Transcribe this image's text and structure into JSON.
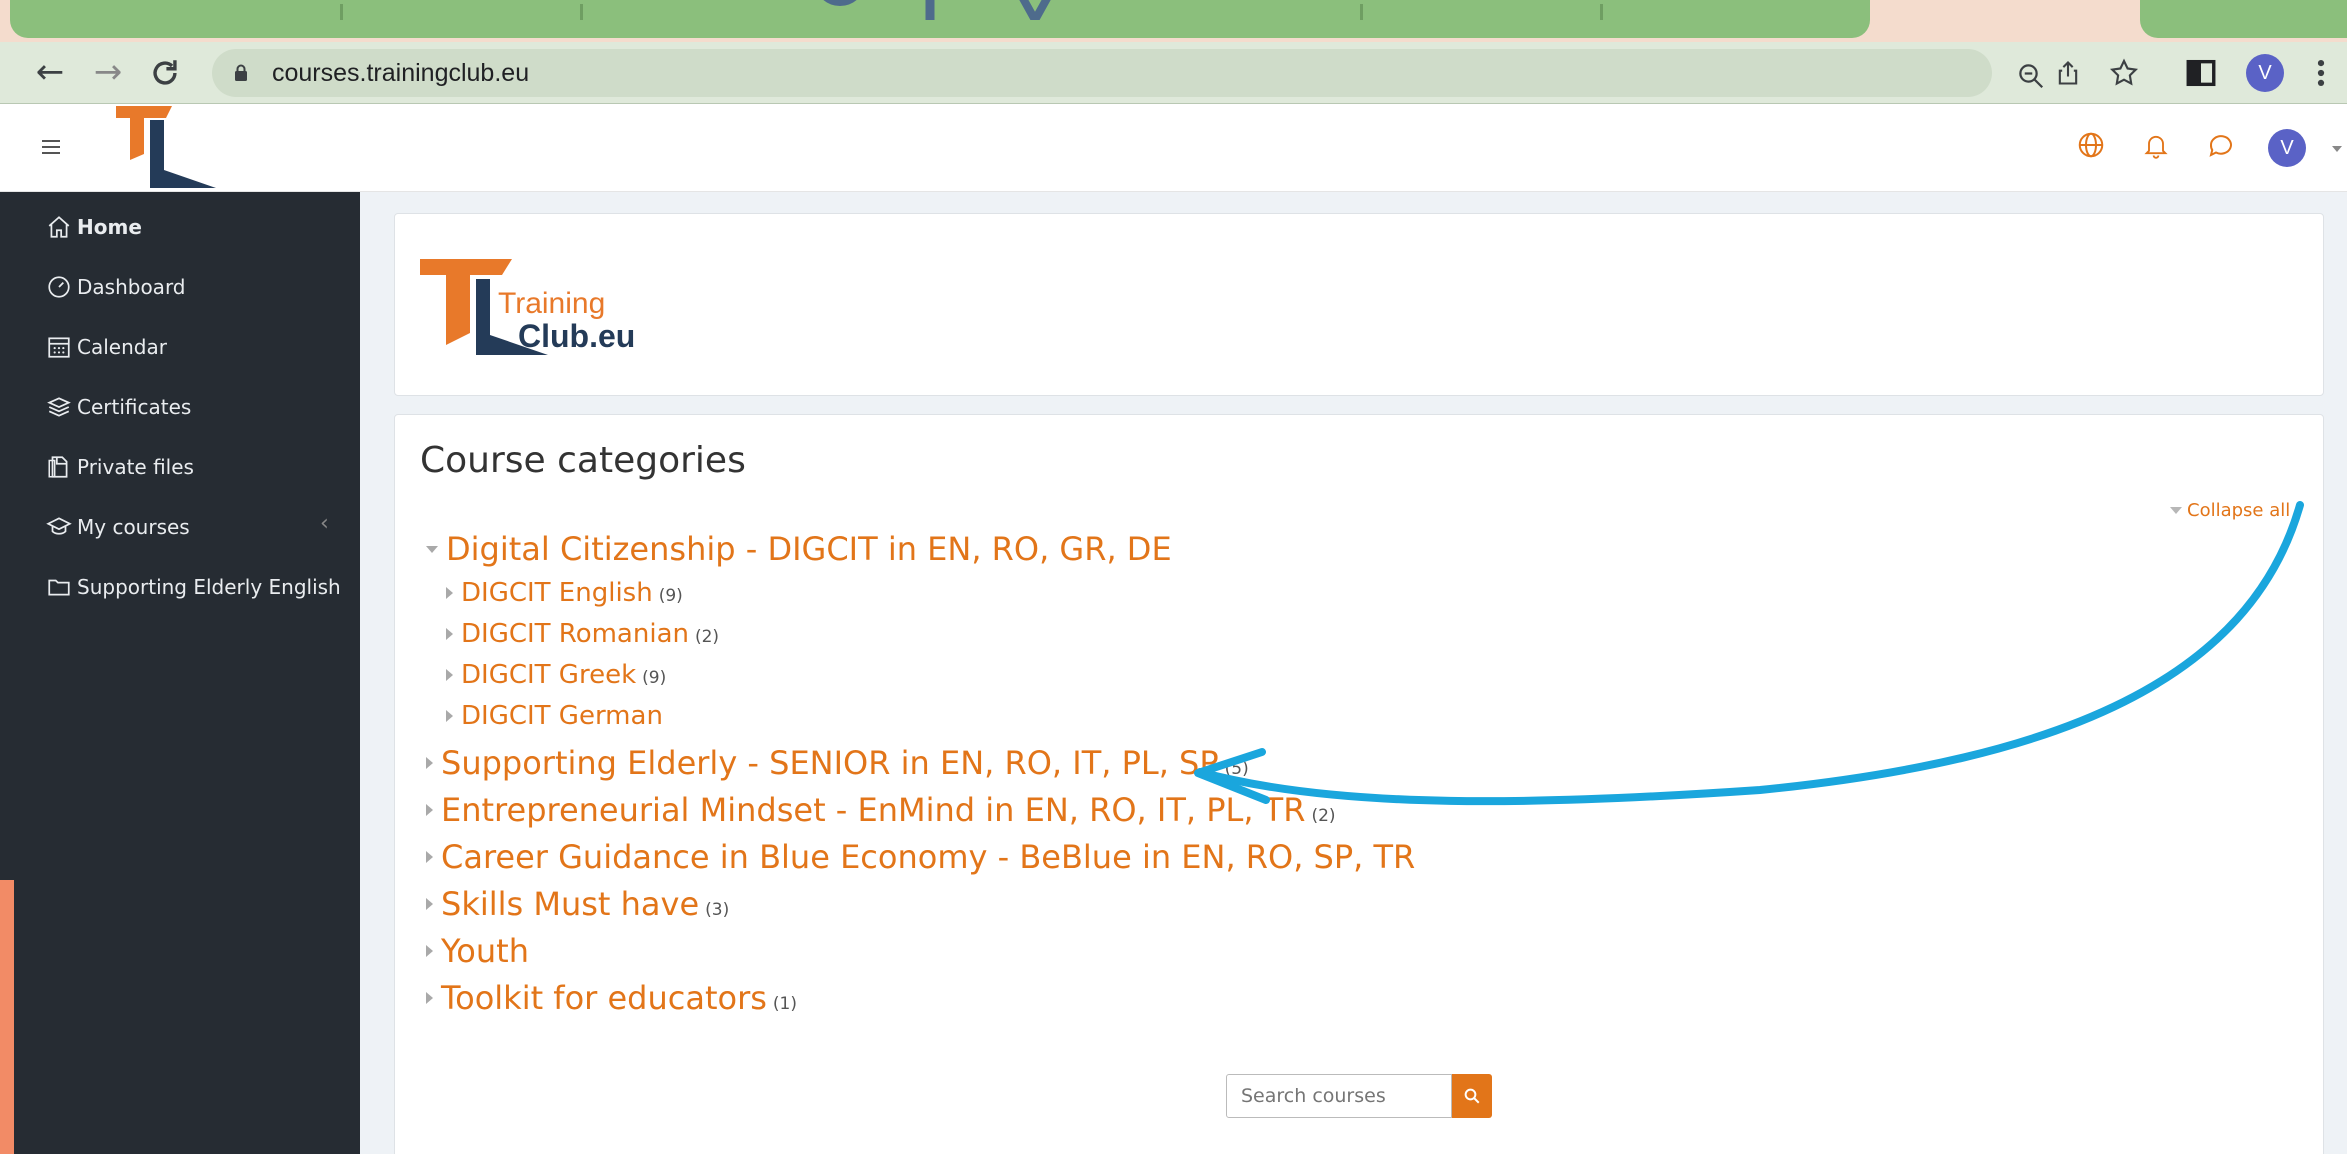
{
  "browser": {
    "url": "courses.trainingclub.eu",
    "profile_initial": "V"
  },
  "navbar": {
    "avatar_initial": "V"
  },
  "logo": {
    "line1": "Training",
    "line2": "Club.eu"
  },
  "sidebar": {
    "items": [
      {
        "label": "Home",
        "icon": "home-icon"
      },
      {
        "label": "Dashboard",
        "icon": "dashboard-icon"
      },
      {
        "label": "Calendar",
        "icon": "calendar-icon"
      },
      {
        "label": "Certificates",
        "icon": "certificates-icon"
      },
      {
        "label": "Private files",
        "icon": "private-files-icon"
      },
      {
        "label": "My courses",
        "icon": "graduation-cap-icon"
      },
      {
        "label": "Supporting Elderly English",
        "icon": "folder-icon"
      }
    ]
  },
  "main": {
    "heading": "Course categories",
    "collapse_all": "Collapse all",
    "categories": [
      {
        "name": "Digital Citizenship - DIGCIT in EN, RO, GR, DE",
        "count": "",
        "expanded": true,
        "children": [
          {
            "name": "DIGCIT English",
            "count": "(9)"
          },
          {
            "name": "DIGCIT Romanian",
            "count": "(2)"
          },
          {
            "name": "DIGCIT Greek",
            "count": "(9)"
          },
          {
            "name": "DIGCIT German",
            "count": ""
          }
        ]
      },
      {
        "name": "Supporting Elderly - SENIOR in EN, RO, IT, PL, SP",
        "count": "(5)"
      },
      {
        "name": "Entrepreneurial Mindset - EnMind in EN, RO, IT, PL, TR",
        "count": "(2)"
      },
      {
        "name": "Career Guidance in Blue Economy - BeBlue in EN, RO, SP, TR",
        "count": ""
      },
      {
        "name": "Skills Must have",
        "count": "(3)"
      },
      {
        "name": "Youth",
        "count": ""
      },
      {
        "name": "Toolkit for educators",
        "count": "(1)"
      }
    ],
    "search_placeholder": "Search courses"
  },
  "colors": {
    "accent": "#e27519",
    "sidebar_bg": "#262c33",
    "annotation_arrow": "#1aa6dd",
    "tab_green": "#8bbf7c"
  }
}
